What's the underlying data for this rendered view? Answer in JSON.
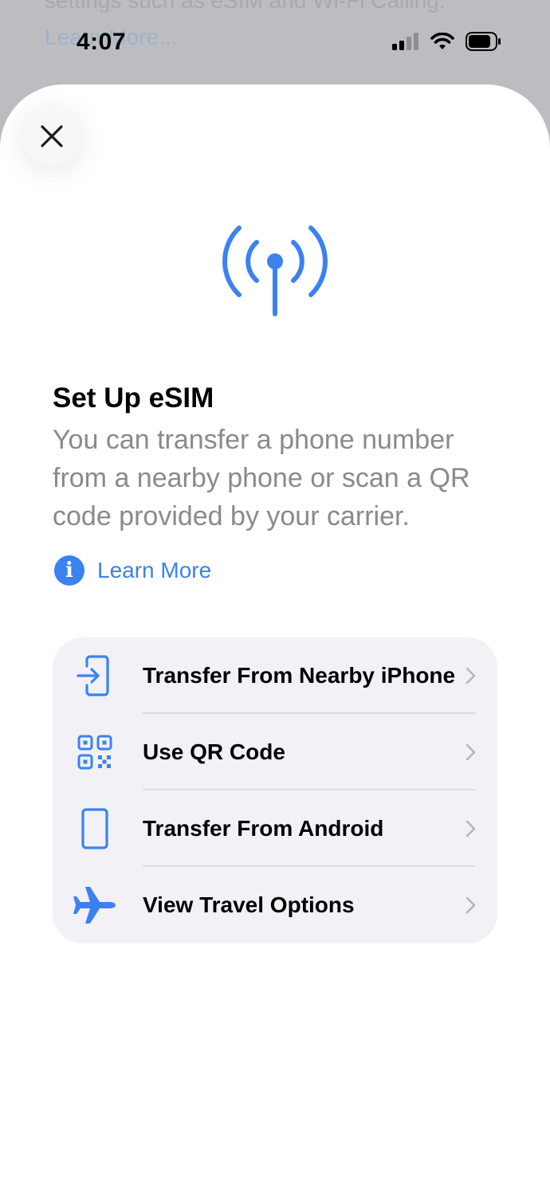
{
  "background": {
    "text_line1": "settings such as eSIM and Wi-Fi Calling.",
    "link": "Learn More..."
  },
  "status_bar": {
    "time": "4:07",
    "icons": [
      "cellular-signal-icon",
      "wifi-icon",
      "battery-icon"
    ]
  },
  "sheet": {
    "close_icon": "close-icon",
    "hero_icon": "antenna-icon",
    "title": "Set Up eSIM",
    "subtitle": "You can transfer a phone number from a nearby phone or scan a QR code provided by your carrier.",
    "learn_more": {
      "icon": "info-icon",
      "icon_glyph": "i",
      "label": "Learn More"
    },
    "options": [
      {
        "label": "Transfer From Nearby iPhone",
        "icon": "phone-transfer-icon"
      },
      {
        "label": "Use QR Code",
        "icon": "qr-code-icon"
      },
      {
        "label": "Transfer From Android",
        "icon": "phone-icon"
      },
      {
        "label": "View Travel Options",
        "icon": "airplane-icon"
      }
    ]
  },
  "colors": {
    "accent": "#3b82f0",
    "secondary_text": "#8a8a8e",
    "list_background": "#f1f1f6",
    "dimmed_background": "#bdbdc1"
  }
}
